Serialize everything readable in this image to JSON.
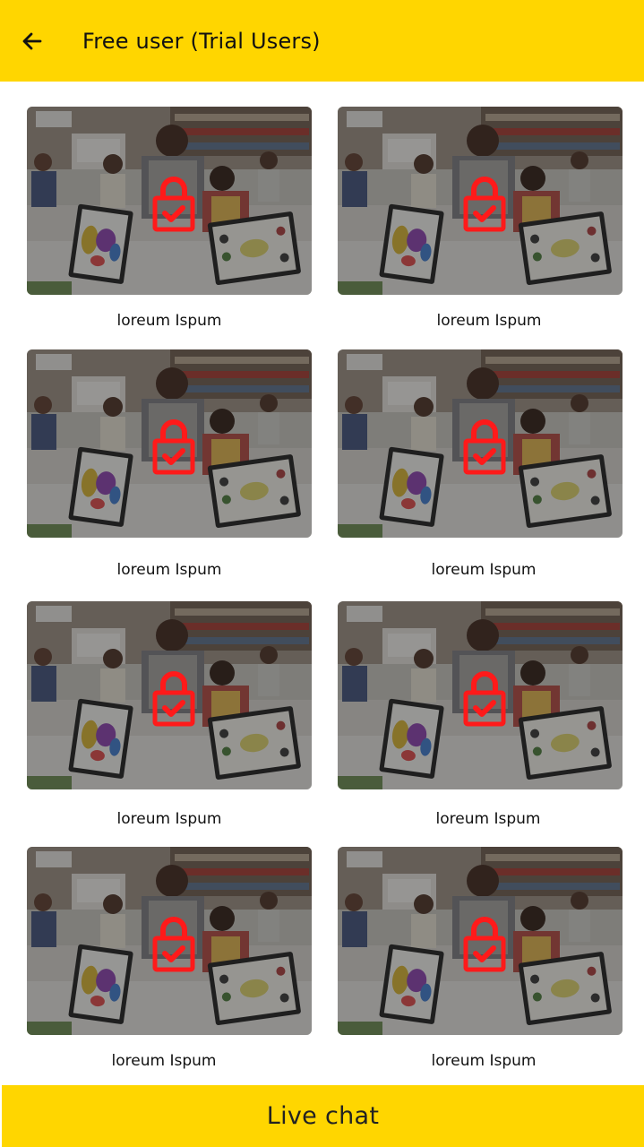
{
  "header": {
    "title": "Free user (Trial Users)",
    "back_icon": "arrow-left-icon"
  },
  "cards": [
    {
      "label": "loreum Ispum",
      "locked": true
    },
    {
      "label": "loreum Ispum",
      "locked": true
    },
    {
      "label": "loreum Ispum",
      "locked": true
    },
    {
      "label": "loreum Ispum",
      "locked": true
    },
    {
      "label": "loreum Ispum",
      "locked": true
    },
    {
      "label": "loreum Ispum",
      "locked": true
    },
    {
      "label": "loreum Ispum",
      "locked": true
    },
    {
      "label": "loreum Ispum",
      "locked": true
    }
  ],
  "footer": {
    "live_chat_label": "Live chat"
  },
  "colors": {
    "accent": "#FFD600",
    "lock": "#FF1A1A"
  },
  "icons": {
    "lock": "lock-check-icon"
  }
}
